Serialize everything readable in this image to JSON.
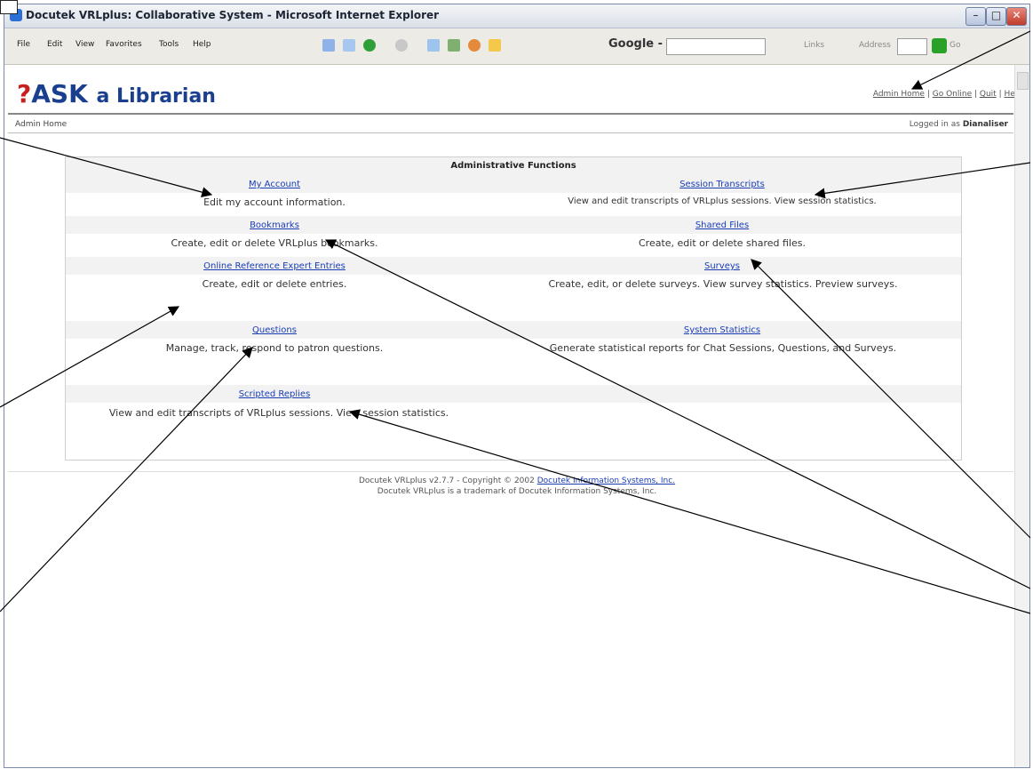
{
  "window": {
    "title": "Docutek VRLplus: Collaborative System - Microsoft Internet Explorer"
  },
  "menus": [
    "File",
    "Edit",
    "View",
    "Favorites",
    "Tools",
    "Help"
  ],
  "toolbar": {
    "google_label": "Google -",
    "links_label": "Links",
    "address_label": "Address",
    "go_label": "Go"
  },
  "logo": {
    "ask": "ASK",
    "rest": "a Librarian"
  },
  "top_links": [
    "Admin Home",
    "Go Online",
    "Quit",
    "Help"
  ],
  "breadcrumb": "Admin Home",
  "logged_in": {
    "prefix": "Logged in as",
    "user": "Dianaliser"
  },
  "panel": {
    "title": "Administrative Functions",
    "functions": [
      {
        "link": "My Account",
        "desc": "Edit my account information."
      },
      {
        "link": "Session Transcripts",
        "desc": "View and edit transcripts of VRLplus sessions. View session statistics."
      },
      {
        "link": "Bookmarks",
        "desc": "Create, edit or delete VRLplus bookmarks."
      },
      {
        "link": "Shared Files",
        "desc": "Create, edit or delete shared files."
      },
      {
        "link": "Online Reference Expert Entries",
        "desc": "Create, edit or delete entries."
      },
      {
        "link": "Surveys",
        "desc": "Create, edit, or delete surveys. View survey statistics. Preview surveys."
      },
      {
        "link": "Questions",
        "desc": "Manage, track, respond to patron questions."
      },
      {
        "link": "System Statistics",
        "desc": "Generate statistical reports for Chat Sessions, Questions, and Surveys."
      },
      {
        "link": "Scripted Replies",
        "desc": "View and edit transcripts of VRLplus sessions. View session statistics."
      }
    ]
  },
  "footer": {
    "line1_prefix": "Docutek VRLplus v2.7.7 - Copyright © 2002",
    "company_link": "Docutek Information Systems, Inc.",
    "line2": "Docutek VRLplus is a trademark of Docutek Information Systems, Inc."
  }
}
